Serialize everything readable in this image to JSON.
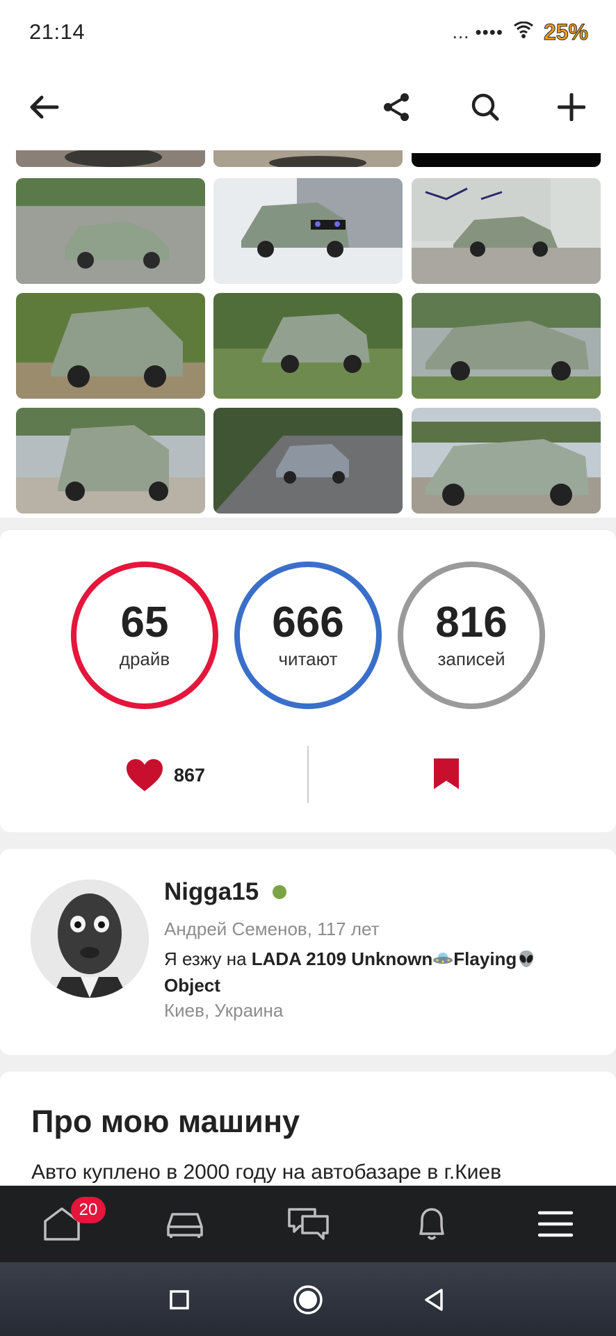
{
  "status_bar": {
    "time": "21:14",
    "indicators": "... ••••",
    "battery": "25%"
  },
  "toolbar": {
    "back_icon": "arrow-left-icon",
    "share_icon": "share-icon",
    "search_icon": "search-icon",
    "add_icon": "plus-icon"
  },
  "stats": {
    "drive": {
      "value": "65",
      "label": "драйв",
      "color": "#e4163b"
    },
    "readers": {
      "value": "666",
      "label": "читают",
      "color": "#3a6fc9"
    },
    "posts": {
      "value": "816",
      "label": "записей",
      "color": "#9a9a9a"
    },
    "likes": "867"
  },
  "profile": {
    "username": "Nigga15",
    "online_color": "#7da443",
    "realname": "Андрей Семенов, 117 лет",
    "car_prefix": "Я езжу на ",
    "car_name_1": "LADA 2109 Unknown",
    "car_name_2": "Flaying",
    "car_name_3": "Object",
    "city": "Киев, Украина"
  },
  "about": {
    "title": "Про мою машину",
    "text": "Авто куплено в 2000 году на автобазаре в г.Киев"
  },
  "bottom_nav": {
    "home_badge": "20",
    "items": [
      "home-icon",
      "car-icon",
      "messages-icon",
      "bell-icon",
      "menu-icon"
    ]
  },
  "colors": {
    "accent_red": "#e4163b",
    "nav_background": "#1e1f21"
  }
}
